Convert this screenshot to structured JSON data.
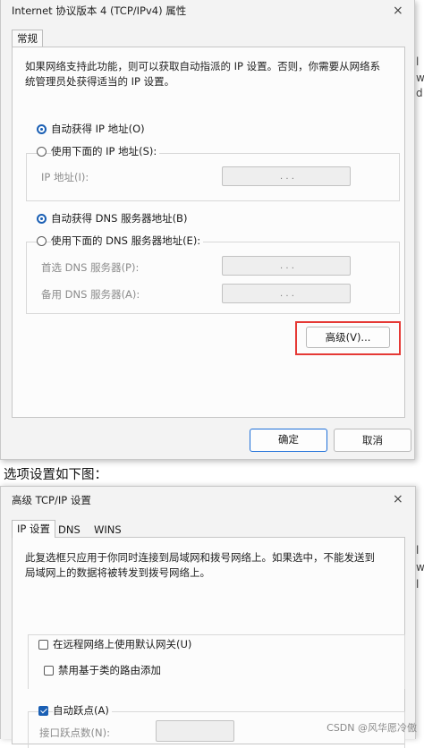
{
  "dialog1": {
    "title": "Internet 协议版本 4 (TCP/IPv4) 属性",
    "close_glyph": "×",
    "tab": "常规",
    "description": "如果网络支持此功能，则可以获取自动指派的 IP 设置。否则，你需要从网络系统管理员处获得适当的 IP 设置。",
    "auto_ip": "自动获得 IP 地址(O)",
    "manual_ip": "使用下面的 IP 地址(S):",
    "ip_address_label": "IP 地址(I):",
    "auto_dns": "自动获得 DNS 服务器地址(B)",
    "manual_dns": "使用下面的 DNS 服务器地址(E):",
    "preferred_dns_label": "首选 DNS 服务器(P):",
    "alternate_dns_label": "备用 DNS 服务器(A):",
    "ip_dots": ".   .   .",
    "advanced_button": "高级(V)...",
    "ok_button": "确定",
    "cancel_button": "取消",
    "auto_ip_selected": true,
    "auto_dns_selected": true,
    "highlight_color": "#e53935",
    "accent_color": "#1a5fb4"
  },
  "between_text": "选项设置如下图：",
  "dialog2": {
    "title": "高级 TCP/IP 设置",
    "close_glyph": "×",
    "tabs": [
      "IP 设置",
      "DNS",
      "WINS"
    ],
    "description": "此复选框只应用于你同时连接到局域网和拨号网络上。如果选中，不能发送到局域网上的数据将被转发到拨号网络上。",
    "use_default_gateway": "在远程网络上使用默认网关(U)",
    "disable_class_routing": "禁用基于类的路由添加",
    "auto_metric": "自动跃点(A)",
    "interface_metric": "接口跃点数(N):",
    "use_default_gateway_checked": false,
    "disable_class_routing_checked": false,
    "auto_metric_checked": true
  },
  "edge_glyphs": [
    "l",
    "w",
    "d",
    "",
    "l",
    "w",
    "l"
  ],
  "watermark": "CSDN @风华愿冷傲"
}
